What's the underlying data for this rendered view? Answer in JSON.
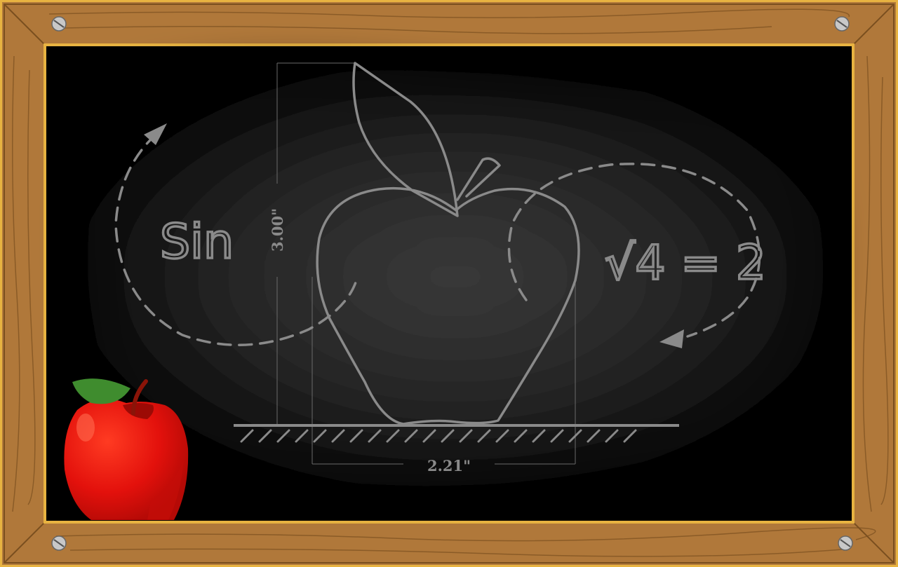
{
  "board": {
    "dimension_height_label": "3.00\"",
    "dimension_width_label": "2.21\"",
    "sketch_sin": "Sin",
    "sketch_equation": "√4 = 2"
  },
  "colors": {
    "frame_wood": "#b0783a",
    "frame_edge": "#e8b341",
    "board": "#000000",
    "chalk": "#8a8a8a",
    "apple_red": "#e3110c",
    "apple_leaf": "#3f8c2e"
  }
}
